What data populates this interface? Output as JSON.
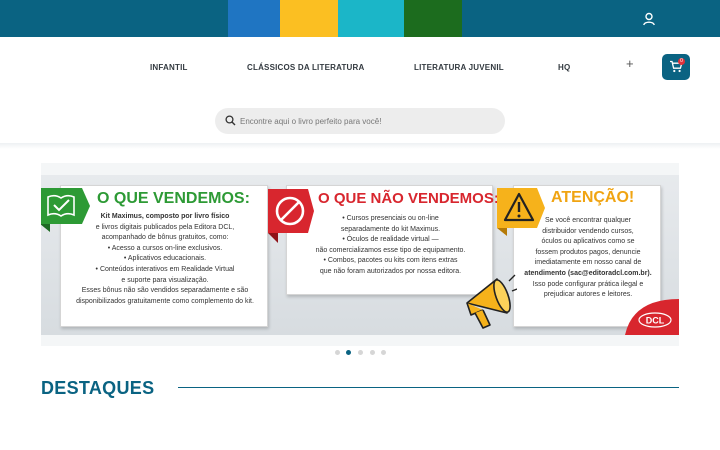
{
  "colors": {
    "brand": "#0a6382",
    "stripe_blue": "#1f75c2",
    "stripe_yellow": "#fbbf22",
    "stripe_cyan": "#1bb6c8",
    "stripe_green": "#1c6c1e",
    "green": "#2d9a35",
    "red": "#d8262e",
    "orange": "#f0a412"
  },
  "topbar": {
    "user_icon": "user-icon"
  },
  "nav": {
    "items": [
      {
        "label": "INFANTIL"
      },
      {
        "label": "CLÁSSICOS DA LITERATURA"
      },
      {
        "label": "LITERATURA JUVENIL"
      },
      {
        "label": "HQ"
      }
    ],
    "more_label": "+",
    "cart_icon": "cart-icon",
    "cart_count": "0"
  },
  "search": {
    "placeholder": "Encontre aqui o livro perfeito para você!",
    "icon": "search-icon"
  },
  "banner": {
    "card1": {
      "icon": "book-check-icon",
      "title": "O QUE VENDEMOS:",
      "lines": [
        "Kit Maximus, composto por livro físico",
        "e livros digitais publicados pela Editora DCL,",
        "acompanhado de bônus gratuitos, como:",
        "• Acesso a cursos on-line exclusivos.",
        "• Aplicativos educacionais.",
        "• Conteúdos interativos em Realidade Virtual",
        "e suporte para visualização.",
        "Esses bônus não são vendidos separadamente e são",
        "disponibilizados gratuitamente como complemento do kit."
      ]
    },
    "card2": {
      "icon": "prohibited-icon",
      "title": "O QUE NÃO VENDEMOS:",
      "lines": [
        "• Cursos presenciais ou on-line",
        "separadamente do kit Maximus.",
        "• Óculos de realidade virtual —",
        "não comercializamos esse tipo de equipamento.",
        "• Combos, pacotes ou kits com itens extras",
        "que não foram autorizados por nossa editora."
      ]
    },
    "card3": {
      "icon": "warning-icon",
      "title": "ATENÇÃO!",
      "lines": [
        "Se você encontrar qualquer",
        "distribuidor vendendo cursos,",
        "óculos ou aplicativos como se",
        "fossem produtos pagos, denuncie",
        "imediatamente em nosso canal de",
        "atendimento (sac@editoradcl.com.br).",
        "Isso pode configurar prática ilegal e",
        "prejudicar autores e leitores."
      ]
    },
    "megaphone_icon": "megaphone-icon",
    "logo_text": "DCL"
  },
  "carousel": {
    "slide_count": 5,
    "active_index": 1
  },
  "section": {
    "title": "DESTAQUES"
  }
}
